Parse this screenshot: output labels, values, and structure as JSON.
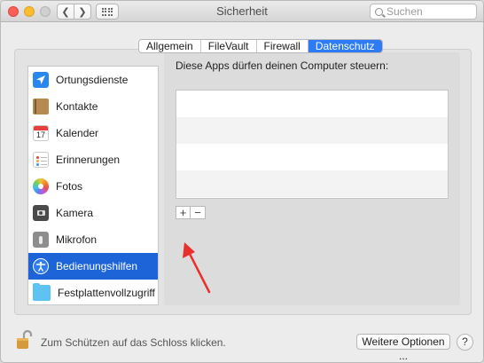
{
  "window": {
    "title": "Sicherheit"
  },
  "toolbar": {
    "back_icon": "chevron-left-icon",
    "forward_icon": "chevron-right-icon",
    "grid_icon": "grid-icon",
    "search_placeholder": "Suchen"
  },
  "tabs": [
    {
      "label": "Allgemein",
      "active": false
    },
    {
      "label": "FileVault",
      "active": false
    },
    {
      "label": "Firewall",
      "active": false
    },
    {
      "label": "Datenschutz",
      "active": true
    }
  ],
  "sidebar": {
    "items": [
      {
        "label": "Ortungsdienste",
        "icon": "location-arrow-icon"
      },
      {
        "label": "Kontakte",
        "icon": "contacts-book-icon"
      },
      {
        "label": "Kalender",
        "icon": "calendar-icon",
        "icon_text": "17"
      },
      {
        "label": "Erinnerungen",
        "icon": "reminders-icon"
      },
      {
        "label": "Fotos",
        "icon": "photos-icon"
      },
      {
        "label": "Kamera",
        "icon": "camera-icon"
      },
      {
        "label": "Mikrofon",
        "icon": "microphone-icon"
      },
      {
        "label": "Bedienungshilfen",
        "icon": "accessibility-icon",
        "selected": true
      },
      {
        "label": "Festplattenvollzugriff",
        "icon": "folder-icon"
      }
    ]
  },
  "content": {
    "description": "Diese Apps dürfen deinen Computer steuern:",
    "add_label": "+",
    "remove_label": "−"
  },
  "footer": {
    "lock_text": "Zum Schützen auf das Schloss klicken.",
    "more_options": "Weitere Optionen ...",
    "help": "?"
  },
  "colors": {
    "accent": "#2e7bf6",
    "selection": "#1c64d8",
    "annotation_arrow": "#e8302c"
  }
}
